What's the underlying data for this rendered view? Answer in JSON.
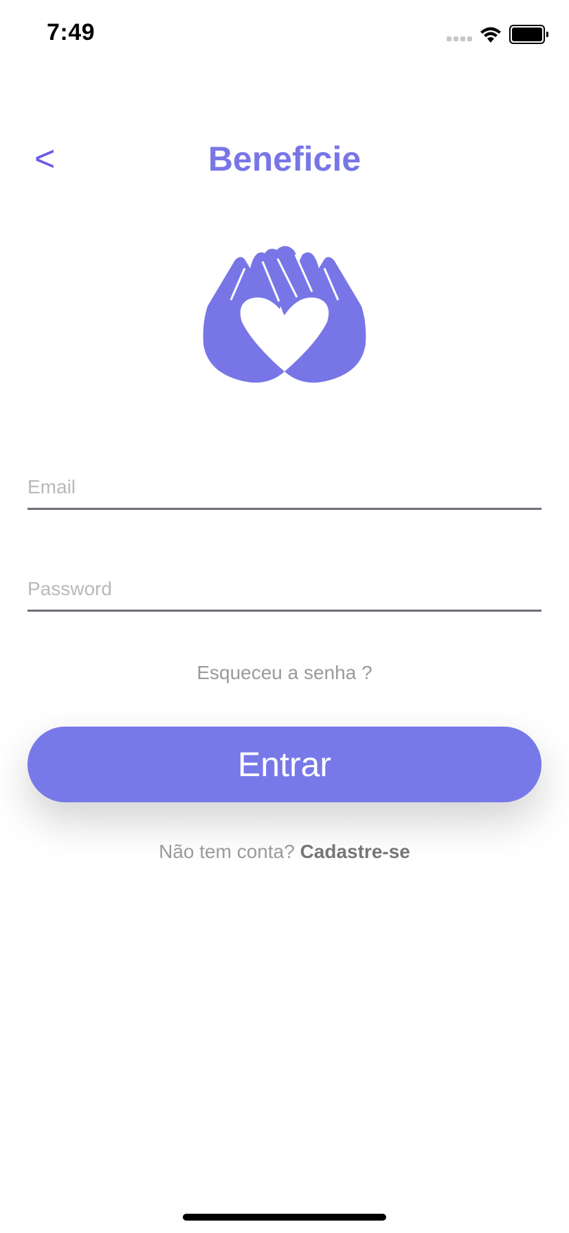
{
  "status_bar": {
    "time": "7:49",
    "icons": [
      "cellular-signal-icon",
      "wifi-icon",
      "battery-icon"
    ],
    "battery_level": 1.0
  },
  "header": {
    "back_label": "<",
    "title": "Beneficie"
  },
  "logo": {
    "icon": "hands-heart-icon",
    "color": "#7876e6"
  },
  "form": {
    "email_placeholder": "Email",
    "email_value": "",
    "password_placeholder": "Password",
    "password_value": ""
  },
  "forgot_password": "Esqueceu a senha ?",
  "login_button": "Entrar",
  "signup": {
    "prompt": "Não tem conta? ",
    "link": "Cadastre-se"
  },
  "colors": {
    "accent": "#7879e8",
    "back_arrow": "#6a5ce5",
    "muted_text": "#9a9a9e",
    "underline": "#6e6e76"
  }
}
